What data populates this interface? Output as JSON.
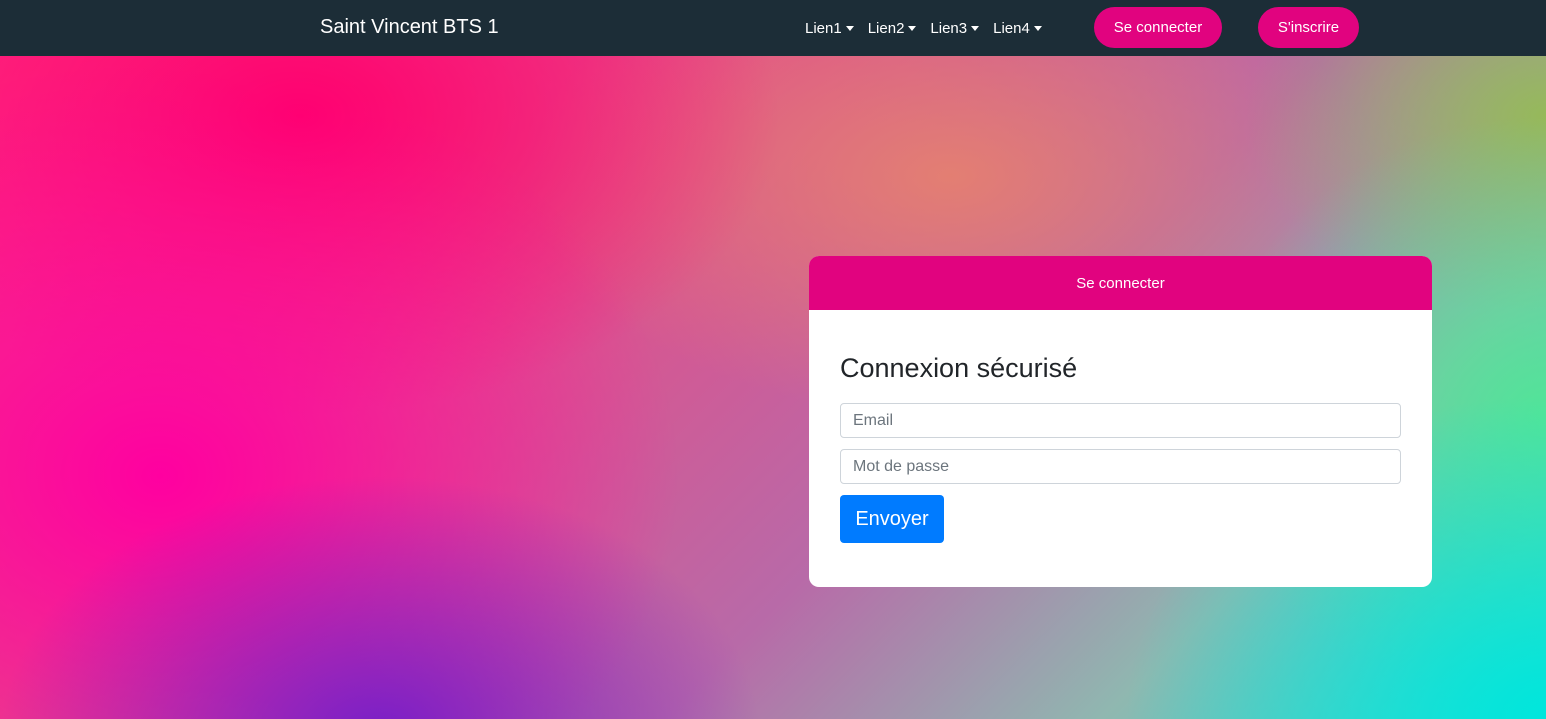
{
  "navbar": {
    "brand": "Saint Vincent BTS 1",
    "links": [
      {
        "label": "Lien1"
      },
      {
        "label": "Lien2"
      },
      {
        "label": "Lien3"
      },
      {
        "label": "Lien4"
      }
    ],
    "login_button": "Se connecter",
    "signup_button": "S'inscrire"
  },
  "login_card": {
    "header": "Se connecter",
    "title": "Connexion sécurisé",
    "email_placeholder": "Email",
    "password_placeholder": "Mot de passe",
    "submit_label": "Envoyer"
  },
  "colors": {
    "navbar_bg": "#1c2d37",
    "accent_pink": "#e1037f",
    "primary_blue": "#007bff"
  },
  "icons": {
    "dropdown": "caret-down-icon"
  }
}
